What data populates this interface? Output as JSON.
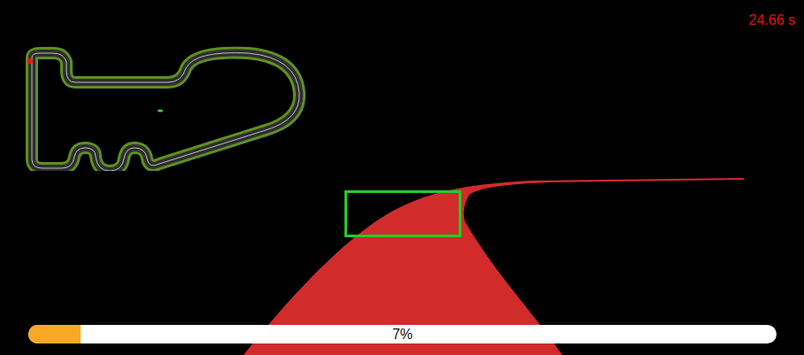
{
  "timer": "24.66 s",
  "progress": {
    "label": "7%",
    "level": 0.07
  }
}
